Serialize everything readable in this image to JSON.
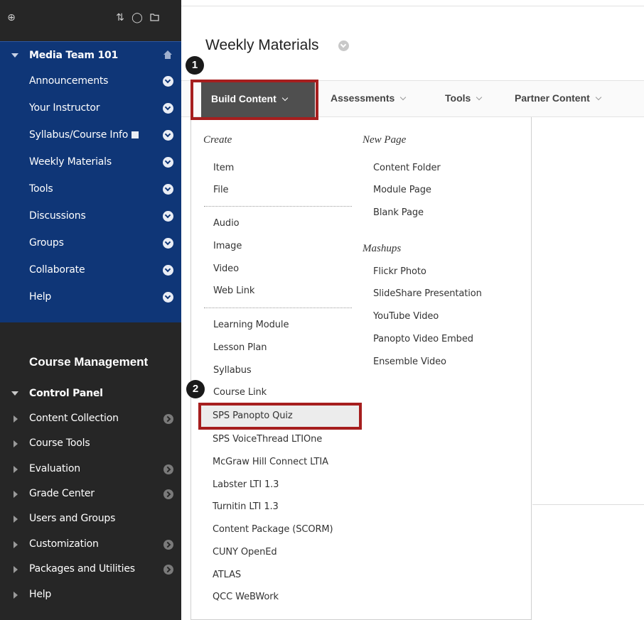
{
  "sidebar": {
    "course_title": "Media Team 101",
    "course_menu": [
      {
        "label": "Announcements"
      },
      {
        "label": "Your Instructor"
      },
      {
        "label": "Syllabus/Course Info"
      },
      {
        "label": "Weekly Materials"
      },
      {
        "label": "Tools"
      },
      {
        "label": "Discussions"
      },
      {
        "label": "Groups"
      },
      {
        "label": "Collaborate"
      },
      {
        "label": "Help"
      }
    ],
    "management_title": "Course Management",
    "control_panel_label": "Control Panel",
    "control_panel": [
      {
        "label": "Content Collection",
        "has_arrow": true
      },
      {
        "label": "Course Tools",
        "has_arrow": false
      },
      {
        "label": "Evaluation",
        "has_arrow": true
      },
      {
        "label": "Grade Center",
        "has_arrow": true
      },
      {
        "label": "Users and Groups",
        "has_arrow": false
      },
      {
        "label": "Customization",
        "has_arrow": true
      },
      {
        "label": "Packages and Utilities",
        "has_arrow": true
      },
      {
        "label": "Help",
        "has_arrow": false
      }
    ]
  },
  "main": {
    "page_title": "Weekly Materials",
    "action_bar": {
      "build_content": "Build Content",
      "assessments": "Assessments",
      "tools": "Tools",
      "partner_content": "Partner Content"
    }
  },
  "dropdown": {
    "create_heading": "Create",
    "create_group1": [
      "Item",
      "File"
    ],
    "create_group2": [
      "Audio",
      "Image",
      "Video",
      "Web Link"
    ],
    "create_group3": [
      "Learning Module",
      "Lesson Plan",
      "Syllabus",
      "Course Link",
      "SPS Panopto Quiz",
      "SPS VoiceThread LTIOne",
      "McGraw Hill Connect LTIA",
      "Labster LTI 1.3",
      "Turnitin LTI 1.3",
      "Content Package (SCORM)",
      "CUNY OpenEd",
      "ATLAS",
      "QCC WeBWork"
    ],
    "newpage_heading": "New Page",
    "newpage_items": [
      "Content Folder",
      "Module Page",
      "Blank Page"
    ],
    "mashups_heading": "Mashups",
    "mashups_items": [
      "Flickr Photo",
      "SlideShare Presentation",
      "YouTube Video",
      "Panopto Video Embed",
      "Ensemble Video"
    ]
  },
  "callouts": {
    "step1": "1",
    "step2": "2",
    "color": "#a61e1e"
  },
  "colors": {
    "course_menu_bg": "#0f3677",
    "sidebar_bg": "#262626",
    "build_button_bg": "#4f4f4f"
  }
}
